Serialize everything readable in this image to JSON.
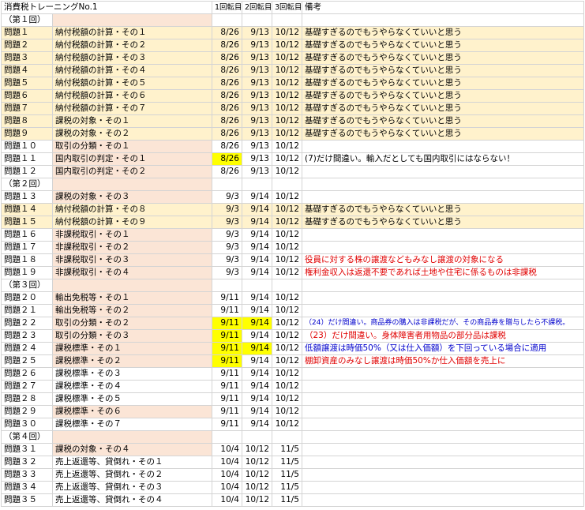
{
  "sheet_title": "消費税トレーニングNo.1",
  "headers": {
    "round1": "1回転目",
    "round2": "2回転目",
    "round3": "3回転目",
    "note": "備考"
  },
  "rows": [
    {
      "section": "（第１回）"
    },
    {
      "q": "問題１",
      "topic": "納付税額の計算・その１",
      "d1": "8/26",
      "d2": "9/13",
      "d3": "10/12",
      "note": "基礎すぎるのでもうやらなくていいと思う",
      "row": "beige"
    },
    {
      "q": "問題２",
      "topic": "納付税額の計算・その２",
      "d1": "8/26",
      "d2": "9/13",
      "d3": "10/12",
      "note": "基礎すぎるのでもうやらなくていいと思う",
      "row": "beige"
    },
    {
      "q": "問題３",
      "topic": "納付税額の計算・その３",
      "d1": "8/26",
      "d2": "9/13",
      "d3": "10/12",
      "note": "基礎すぎるのでもうやらなくていいと思う",
      "row": "beige"
    },
    {
      "q": "問題４",
      "topic": "納付税額の計算・その４",
      "d1": "8/26",
      "d2": "9/13",
      "d3": "10/12",
      "note": "基礎すぎるのでもうやらなくていいと思う",
      "row": "beige"
    },
    {
      "q": "問題５",
      "topic": "納付税額の計算・その５",
      "d1": "8/26",
      "d2": "9/13",
      "d3": "10/12",
      "note": "基礎すぎるのでもうやらなくていいと思う",
      "row": "beige"
    },
    {
      "q": "問題６",
      "topic": "納付税額の計算・その６",
      "d1": "8/26",
      "d2": "9/13",
      "d3": "10/12",
      "note": "基礎すぎるのでもうやらなくていいと思う",
      "row": "beige"
    },
    {
      "q": "問題７",
      "topic": "納付税額の計算・その７",
      "d1": "8/26",
      "d2": "9/13",
      "d3": "10/12",
      "note": "基礎すぎるのでもうやらなくていいと思う",
      "row": "beige"
    },
    {
      "q": "問題８",
      "topic": "課税の対象・その１",
      "d1": "8/26",
      "d2": "9/13",
      "d3": "10/12",
      "note": "基礎すぎるのでもうやらなくていいと思う",
      "row": "beige"
    },
    {
      "q": "問題９",
      "topic": "課税の対象・その２",
      "d1": "8/26",
      "d2": "9/13",
      "d3": "10/12",
      "note": "基礎すぎるのでもうやらなくていいと思う",
      "row": "beige"
    },
    {
      "q": "問題１０",
      "topic": "取引の分類・その１",
      "d1": "8/26",
      "d2": "9/13",
      "d3": "10/12",
      "note": "",
      "topic_bg": "orange"
    },
    {
      "q": "問題１１",
      "topic": "国内取引の判定・その１",
      "d1": "8/26",
      "d2": "9/13",
      "d3": "10/12",
      "note": "(7)だけ間違い。輸入だとしても国内取引にはならない！",
      "topic_bg": "orange",
      "d1_bg": "yellow"
    },
    {
      "q": "問題１２",
      "topic": "国内取引の判定・その２",
      "d1": "8/26",
      "d2": "9/13",
      "d3": "10/12",
      "note": "",
      "topic_bg": "orange"
    },
    {
      "section": "（第２回）"
    },
    {
      "q": "問題１３",
      "topic": "課税の対象・その３",
      "d1": "9/3",
      "d2": "9/14",
      "d3": "10/12",
      "note": "",
      "topic_bg": "orange"
    },
    {
      "q": "問題１４",
      "topic": "納付税額の計算・その８",
      "d1": "9/3",
      "d2": "9/14",
      "d3": "10/12",
      "note": "基礎すぎるのでもうやらなくていいと思う",
      "row": "beige"
    },
    {
      "q": "問題１５",
      "topic": "納付税額の計算・その９",
      "d1": "9/3",
      "d2": "9/14",
      "d3": "10/12",
      "note": "基礎すぎるのでもうやらなくていいと思う",
      "row": "beige"
    },
    {
      "q": "問題１６",
      "topic": "非課税取引・その１",
      "d1": "9/3",
      "d2": "9/14",
      "d3": "10/12",
      "note": "",
      "topic_bg": "orange"
    },
    {
      "q": "問題１７",
      "topic": "非課税取引・その２",
      "d1": "9/3",
      "d2": "9/14",
      "d3": "10/12",
      "note": "",
      "topic_bg": "orange"
    },
    {
      "q": "問題１８",
      "topic": "非課税取引・その３",
      "d1": "9/3",
      "d2": "9/14",
      "d3": "10/12",
      "note": "役員に対する株の譲渡などもみなし譲渡の対象になる",
      "topic_bg": "orange",
      "note_color": "red"
    },
    {
      "q": "問題１９",
      "topic": "非課税取引・その４",
      "d1": "9/3",
      "d2": "9/14",
      "d3": "10/12",
      "note": "権利金収入は返還不要であれば土地や住宅に係るものは非課税",
      "topic_bg": "orange",
      "note_color": "red"
    },
    {
      "section": "（第３回）"
    },
    {
      "q": "問題２０",
      "topic": "輸出免税等・その１",
      "d1": "9/11",
      "d2": "9/14",
      "d3": "10/12",
      "note": "",
      "topic_bg": "orange"
    },
    {
      "q": "問題２１",
      "topic": "輸出免税等・その２",
      "d1": "9/11",
      "d2": "9/14",
      "d3": "10/12",
      "note": "",
      "topic_bg": "orange"
    },
    {
      "q": "問題２２",
      "topic": "取引の分類・その２",
      "d1": "9/11",
      "d2": "9/14",
      "d3": "10/12",
      "note": "（24）だけ間違い。商品券の購入は非課税だが、その商品券を贈与したら不課税。",
      "topic_bg": "orange",
      "d1_bg": "yellow",
      "d2_bg": "yellow",
      "note_color": "blue",
      "note_small": true
    },
    {
      "q": "問題２３",
      "topic": "取引の分類・その３",
      "d1": "9/11",
      "d2": "9/14",
      "d3": "10/12",
      "note": "（23）だけ間違い。身体障害者用物品の部分品は課税",
      "topic_bg": "orange",
      "d1_bg": "yellow",
      "note_color": "red"
    },
    {
      "q": "問題２４",
      "topic": "課税標準・その１",
      "d1": "9/11",
      "d2": "9/14",
      "d3": "10/12",
      "note": "低額譲渡は時価50%（又は仕入価額）を下回っている場合に適用",
      "topic_bg": "orange",
      "d1_bg": "yellow",
      "d2_bg": "yellow",
      "note_color": "blue"
    },
    {
      "q": "問題２５",
      "topic": "課税標準・その２",
      "d1": "9/11",
      "d2": "9/14",
      "d3": "10/12",
      "note": "棚卸資産のみなし譲渡は時価50%か仕入価額を売上に",
      "topic_bg": "orange",
      "d1_bg": "yellow",
      "note_color": "red"
    },
    {
      "q": "問題２６",
      "topic": "課税標準・その３",
      "d1": "9/11",
      "d2": "9/14",
      "d3": "10/12",
      "note": ""
    },
    {
      "q": "問題２７",
      "topic": "課税標準・その４",
      "d1": "9/11",
      "d2": "9/14",
      "d3": "10/12",
      "note": ""
    },
    {
      "q": "問題２８",
      "topic": "課税標準・その５",
      "d1": "9/11",
      "d2": "9/14",
      "d3": "10/12",
      "note": ""
    },
    {
      "q": "問題２９",
      "topic": "課税標準・その６",
      "d1": "9/11",
      "d2": "9/14",
      "d3": "10/12",
      "note": "",
      "topic_bg": "orange"
    },
    {
      "q": "問題３０",
      "topic": "課税標準・その７",
      "d1": "9/11",
      "d2": "9/14",
      "d3": "10/12",
      "note": ""
    },
    {
      "section": "（第４回）"
    },
    {
      "q": "問題３１",
      "topic": "課税の対象・その４",
      "d1": "10/4",
      "d2": "10/12",
      "d3": "11/5",
      "note": "",
      "topic_bg": "orange"
    },
    {
      "q": "問題３２",
      "topic": "売上返還等、貸倒れ・その１",
      "d1": "10/4",
      "d2": "10/12",
      "d3": "11/5",
      "note": ""
    },
    {
      "q": "問題３３",
      "topic": "売上返還等、貸倒れ・その２",
      "d1": "10/4",
      "d2": "10/12",
      "d3": "11/5",
      "note": ""
    },
    {
      "q": "問題３４",
      "topic": "売上返還等、貸倒れ・その３",
      "d1": "10/4",
      "d2": "10/12",
      "d3": "11/5",
      "note": ""
    },
    {
      "q": "問題３５",
      "topic": "売上返還等、貸倒れ・その４",
      "d1": "10/4",
      "d2": "10/12",
      "d3": "11/5",
      "note": ""
    }
  ]
}
